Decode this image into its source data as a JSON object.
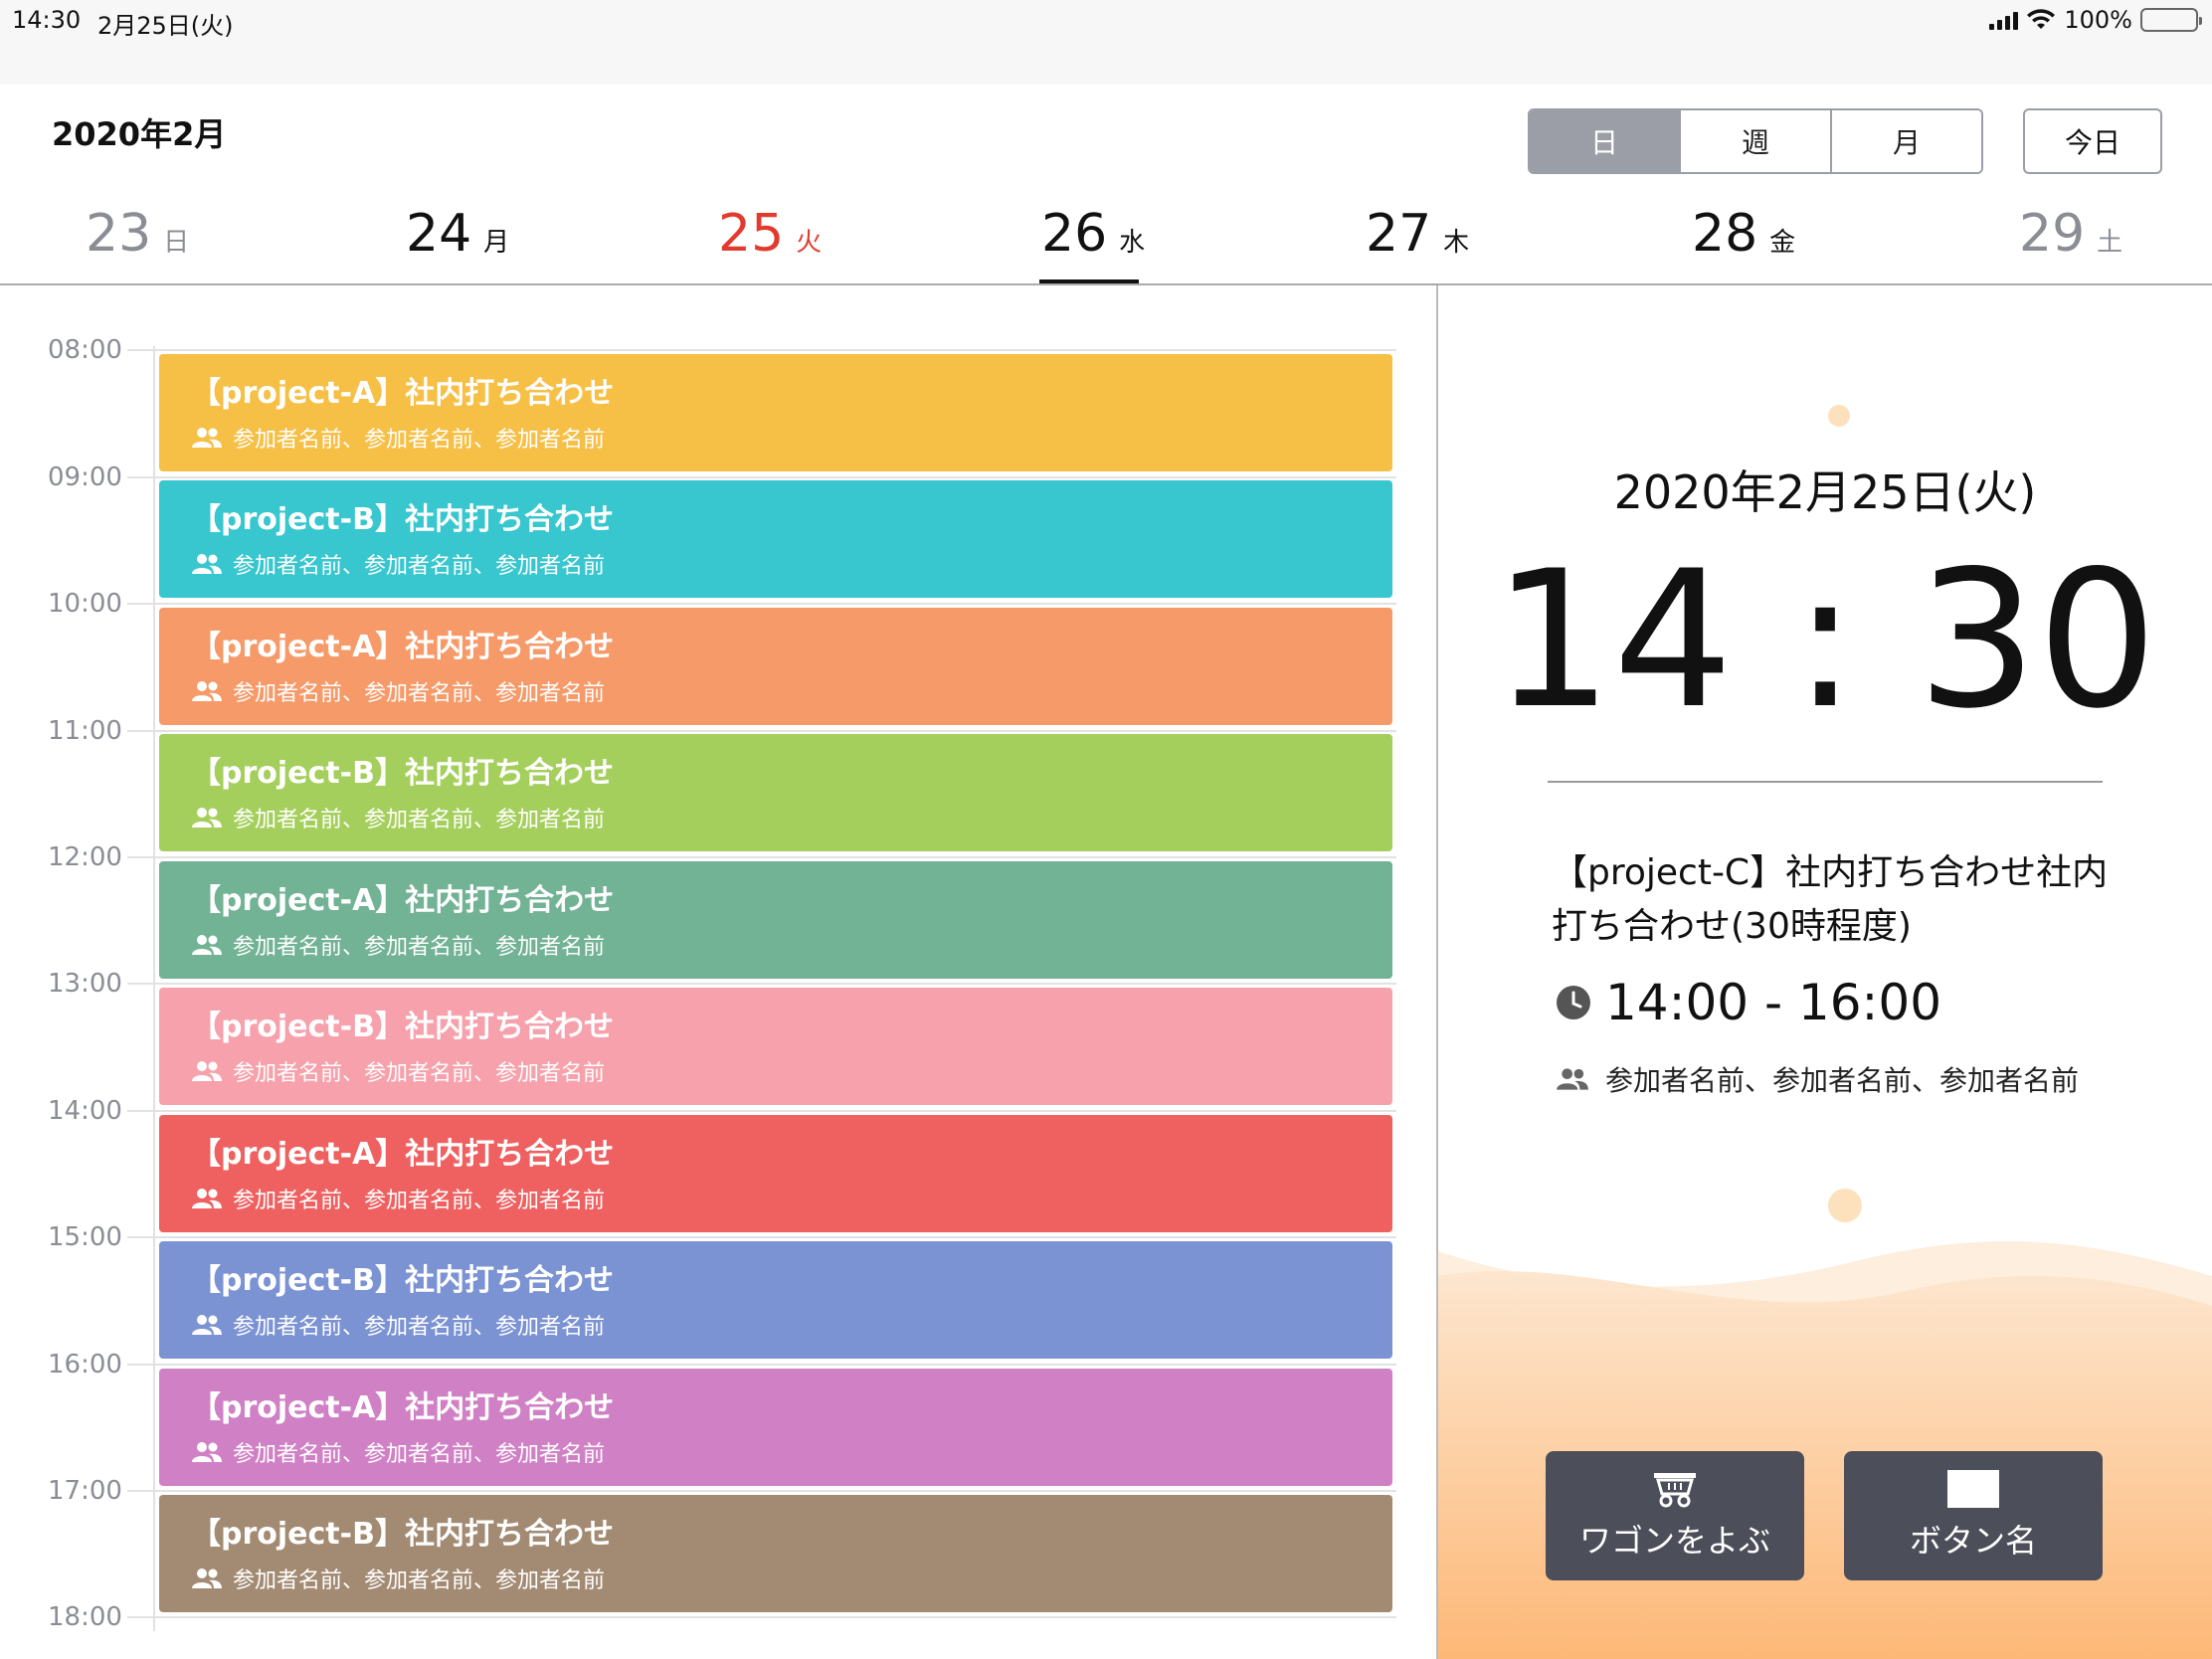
{
  "status_bar": {
    "time": "14:30",
    "date": "2月25日(火)",
    "battery_pct": "100%"
  },
  "header": {
    "month_title": "2020年2月"
  },
  "view_switch": {
    "day": "日",
    "week": "週",
    "month": "月",
    "selected": "日"
  },
  "today_button": "今日",
  "week_days": [
    {
      "num": "23",
      "wd": "日"
    },
    {
      "num": "24",
      "wd": "月"
    },
    {
      "num": "25",
      "wd": "火"
    },
    {
      "num": "26",
      "wd": "水"
    },
    {
      "num": "27",
      "wd": "木"
    },
    {
      "num": "28",
      "wd": "金"
    },
    {
      "num": "29",
      "wd": "土"
    }
  ],
  "hours": [
    "08:00",
    "09:00",
    "10:00",
    "11:00",
    "12:00",
    "13:00",
    "14:00",
    "15:00",
    "16:00",
    "17:00",
    "18:00"
  ],
  "events": [
    {
      "title": "【project-A】社内打ち合わせ",
      "people": "参加者名前、参加者名前、参加者名前",
      "color": "#f6bf45"
    },
    {
      "title": "【project-B】社内打ち合わせ",
      "people": "参加者名前、参加者名前、参加者名前",
      "color": "#38c6cf"
    },
    {
      "title": "【project-A】社内打ち合わせ",
      "people": "参加者名前、参加者名前、参加者名前",
      "color": "#f59a68"
    },
    {
      "title": "【project-B】社内打ち合わせ",
      "people": "参加者名前、参加者名前、参加者名前",
      "color": "#a5cf5c"
    },
    {
      "title": "【project-A】社内打ち合わせ",
      "people": "参加者名前、参加者名前、参加者名前",
      "color": "#72b295"
    },
    {
      "title": "【project-B】社内打ち合わせ",
      "people": "参加者名前、参加者名前、参加者名前",
      "color": "#f6a1ab"
    },
    {
      "title": "【project-A】社内打ち合わせ",
      "people": "参加者名前、参加者名前、参加者名前",
      "color": "#ef6060"
    },
    {
      "title": "【project-B】社内打ち合わせ",
      "people": "参加者名前、参加者名前、参加者名前",
      "color": "#7b93d3"
    },
    {
      "title": "【project-A】社内打ち合わせ",
      "people": "参加者名前、参加者名前、参加者名前",
      "color": "#d081c5"
    },
    {
      "title": "【project-B】社内打ち合わせ",
      "people": "参加者名前、参加者名前、参加者名前",
      "color": "#a38b73"
    }
  ],
  "panel": {
    "date": "2020年2月25日(火)",
    "clock": "14 : 30",
    "current_title": "【project-C】社内打ち合わせ社内打ち合わせ(30時程度)",
    "current_time": "14:00 - 16:00",
    "current_people": "参加者名前、参加者名前、参加者名前",
    "button1": "ワゴンをよぶ",
    "button2": "ボタン名"
  },
  "colors": {
    "today": "#e23a2e",
    "muted": "#8a8d94",
    "button_bg": "#4c4e59",
    "accent_wave": "#fdb877"
  }
}
